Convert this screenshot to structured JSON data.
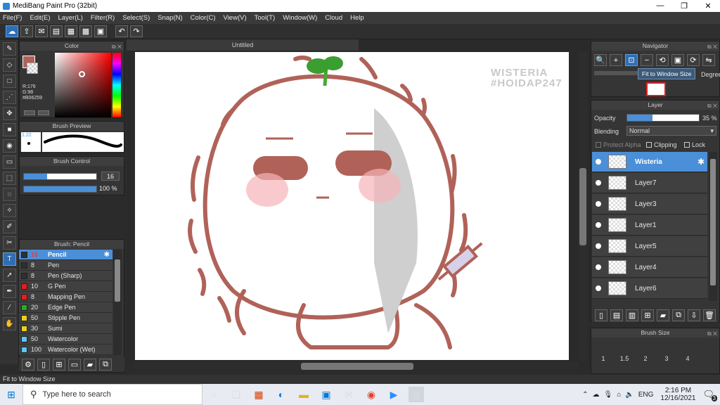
{
  "window": {
    "title": "MediBang Paint Pro (32bit)",
    "min": "—",
    "restore": "❐",
    "close": "✕"
  },
  "menu": [
    "File(F)",
    "Edit(E)",
    "Layer(L)",
    "Filter(R)",
    "Select(S)",
    "Snap(N)",
    "Color(C)",
    "View(V)",
    "Tool(T)",
    "Window(W)",
    "Cloud",
    "Help"
  ],
  "panels": {
    "color": "Color",
    "brush_preview": "Brush Preview",
    "brush_control": "Brush Control",
    "brush_list": "Brush: Pencil",
    "navigator": "Navigator",
    "layer": "Layer",
    "brush_size": "Brush Size"
  },
  "color": {
    "r": "R:176",
    "g": "G:98",
    "hex": "#B06259",
    "primary": "#b06259"
  },
  "brush_preview": {
    "size": "1.22"
  },
  "brush_control": {
    "size": "16",
    "opacity": "100 %"
  },
  "brushes": [
    {
      "size": "16",
      "name": "Pencil",
      "color": "#2f2f2f"
    },
    {
      "size": "8",
      "name": "Pen",
      "color": "#2f2f2f"
    },
    {
      "size": "8",
      "name": "Pen (Sharp)",
      "color": "#2f2f2f"
    },
    {
      "size": "10",
      "name": "G Pen",
      "color": "#e02020"
    },
    {
      "size": "8",
      "name": "Mapping Pen",
      "color": "#e02020"
    },
    {
      "size": "20",
      "name": "Edge Pen",
      "color": "#22b022"
    },
    {
      "size": "50",
      "name": "Stipple Pen",
      "color": "#e8d020"
    },
    {
      "size": "30",
      "name": "Sumi",
      "color": "#e8d020"
    },
    {
      "size": "50",
      "name": "Watercolor",
      "color": "#5ac8f0"
    },
    {
      "size": "100",
      "name": "Watercolor (Wet)",
      "color": "#5ac8f0"
    }
  ],
  "canvas": {
    "tab": "Untitled",
    "watermark_line1": "WISTERIA",
    "watermark_line2": "#HOIDAP247"
  },
  "navigator": {
    "tooltip": "Fit to Window Size",
    "degree": "Degree"
  },
  "layer_panel": {
    "opacity_label": "Opacity",
    "opacity_value": "35 %",
    "opacity_level": 0.35,
    "blending_label": "Blending",
    "blending_value": "Normal",
    "protect_alpha": "Protect Alpha",
    "clipping": "Clipping",
    "lock": "Lock",
    "layers": [
      "Wisteria",
      "Layer7",
      "Layer3",
      "Layer1",
      "Layer5",
      "Layer4",
      "Layer6"
    ]
  },
  "brush_size": {
    "labels": [
      "1",
      "1.5",
      "2",
      "3",
      "4"
    ]
  },
  "status": "Fit to Window Size",
  "taskbar": {
    "search_placeholder": "Type here to search",
    "time": "2:16 PM",
    "date": "12/16/2021",
    "lang": "ENG",
    "notif": "3"
  }
}
